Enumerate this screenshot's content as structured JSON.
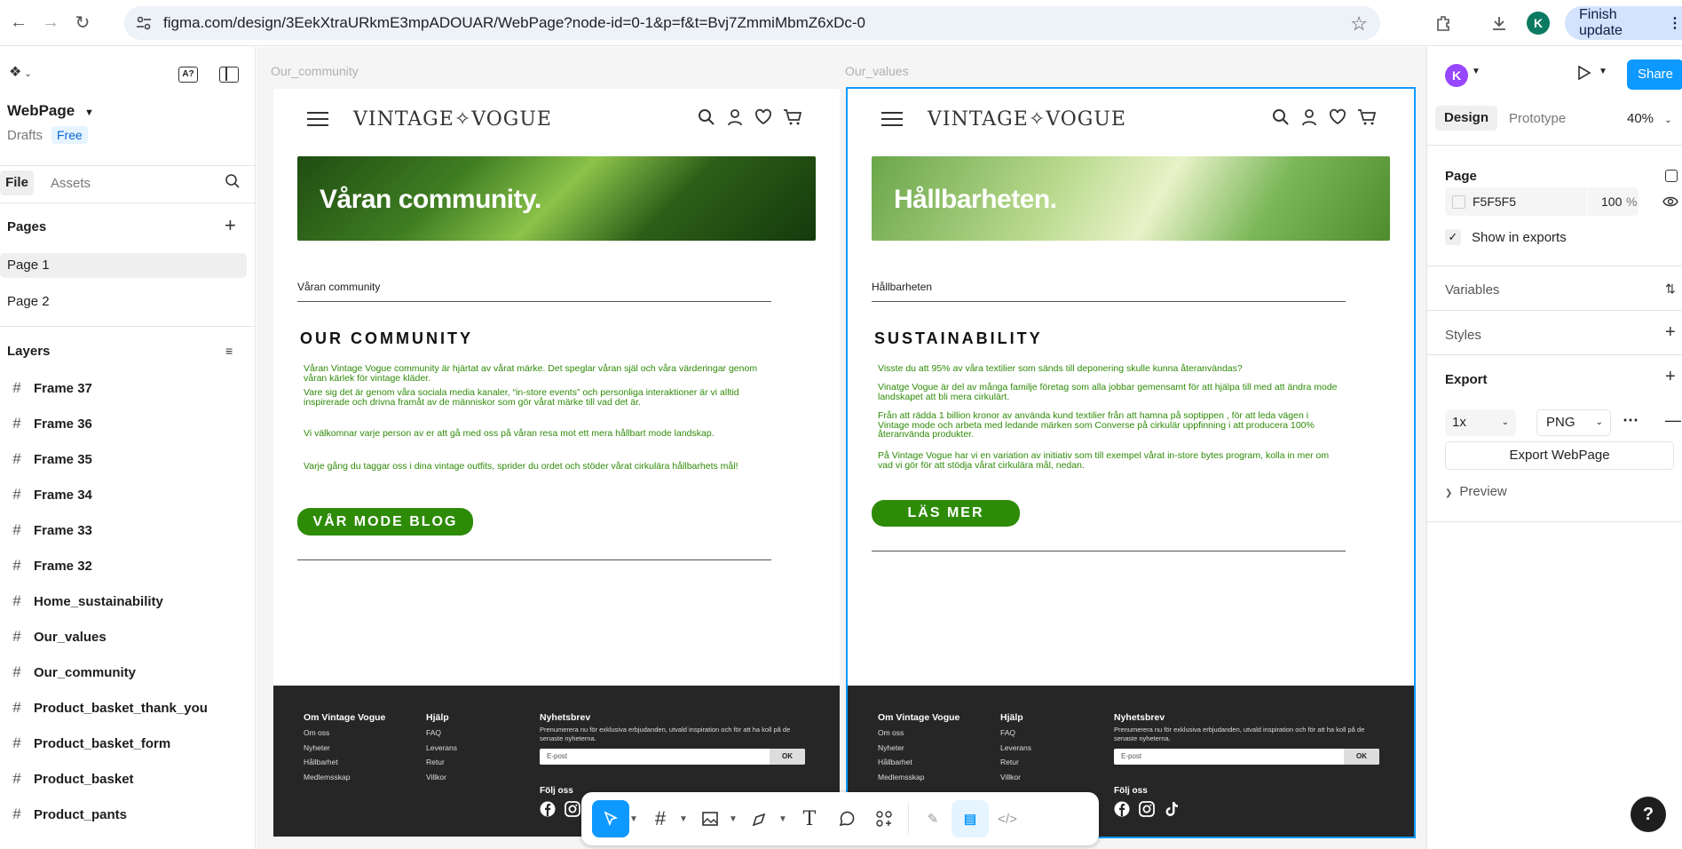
{
  "browser": {
    "url": "figma.com/design/3EekXtraURkmE3mpADOUAR/WebPage?node-id=0-1&p=f&t=Bvj7ZmmiMbmZ6xDc-0",
    "avatar": "K",
    "finish_update": "Finish update"
  },
  "left_panel": {
    "file_name": "WebPage",
    "drafts": "Drafts",
    "plan": "Free",
    "tab_file": "File",
    "tab_assets": "Assets",
    "pages_title": "Pages",
    "pages": [
      "Page 1",
      "Page 2"
    ],
    "layers_title": "Layers",
    "layers": [
      "Frame 37",
      "Frame 36",
      "Frame 35",
      "Frame 34",
      "Frame 33",
      "Frame 32",
      "Home_sustainability",
      "Our_values",
      "Our_community",
      "Product_basket_thank_you",
      "Product_basket_form",
      "Product_basket",
      "Product_pants"
    ]
  },
  "frames": [
    {
      "label": "Our_community",
      "brand": "VINTAGE✧VOGUE",
      "banner": "Våran community.",
      "crumb": "Våran community",
      "title": "OUR COMMUNITY",
      "paragraphs": [
        "Våran Vintage Vogue community är hjärtat av vårat märke. Det speglar våran själ och våra värderingar genom våran kärlek för vintage kläder.",
        "Vare sig det är genom våra sociala media kanaler, “in-store events” och personliga interaktioner är vi alltid inspirerade och drivna framåt av de människor som gör vårat märke till vad det är.",
        "Vi välkomnar varje person av er att gå med oss på våran resa mot ett mera hållbart mode landskap.",
        "Varje gång du taggar oss i dina vintage outfits, sprider du ordet och stöder vårat cirkulära hållbarhets mål!"
      ],
      "button": "VÅR MODE BLOG"
    },
    {
      "label": "Our_values",
      "brand": "VINTAGE✧VOGUE",
      "banner": "Hållbarheten.",
      "crumb": "Hållbarheten",
      "title": "SUSTAINABILITY",
      "paragraphs": [
        "Visste du att 95% av våra textilier som sänds till deponering skulle kunna återanvändas?",
        "Vinatge Vogue är del av många familje företag som alla jobbar gemensamt för att hjälpa till med att ändra mode landskapet att bli mera cirkulärt.",
        "Från att rädda 1 billion kronor av använda kund textilier från att hamna på soptippen , för att leda vägen i Vintage mode och arbeta med ledande märken som Converse på cirkulär uppfinning i att producera 100% återanvända produkter.",
        "På Vintage Vogue har vi en variation av initiativ som till exempel vårat in-store bytes program, kolla in mer om vad vi gör för att stödja vårat cirkulära mål, nedan."
      ],
      "button": "LÄS MER"
    }
  ],
  "footer": {
    "col1_title": "Om Vintage Vogue",
    "col1": [
      "Om oss",
      "Nyheter",
      "Hållbarhet",
      "Medlemsskap"
    ],
    "col2_title": "Hjälp",
    "col2": [
      "FAQ",
      "Leverans",
      "Retur",
      "Villkor"
    ],
    "news_title": "Nyhetsbrev",
    "news_desc": "Prenumerera nu för exklusiva erbjudanden, utvald inspiration och för att ha koll på de senaste nyheterna.",
    "email_placeholder": "E-post",
    "ok": "OK",
    "follow": "Följ oss"
  },
  "right_panel": {
    "avatar": "K",
    "share": "Share",
    "tab_design": "Design",
    "tab_prototype": "Prototype",
    "zoom": "40%",
    "page_title": "Page",
    "page_color": "F5F5F5",
    "page_opacity": "100",
    "percent": "%",
    "show_in_exports": "Show in exports",
    "variables": "Variables",
    "styles": "Styles",
    "export": "Export",
    "scale": "1x",
    "format": "PNG",
    "export_button": "Export WebPage",
    "preview": "Preview"
  },
  "colors": {
    "accent": "#0d99ff",
    "brand_green": "#2e8b07",
    "footer_bg": "#262626",
    "share_btn": "#0d99ff"
  },
  "help": "?"
}
